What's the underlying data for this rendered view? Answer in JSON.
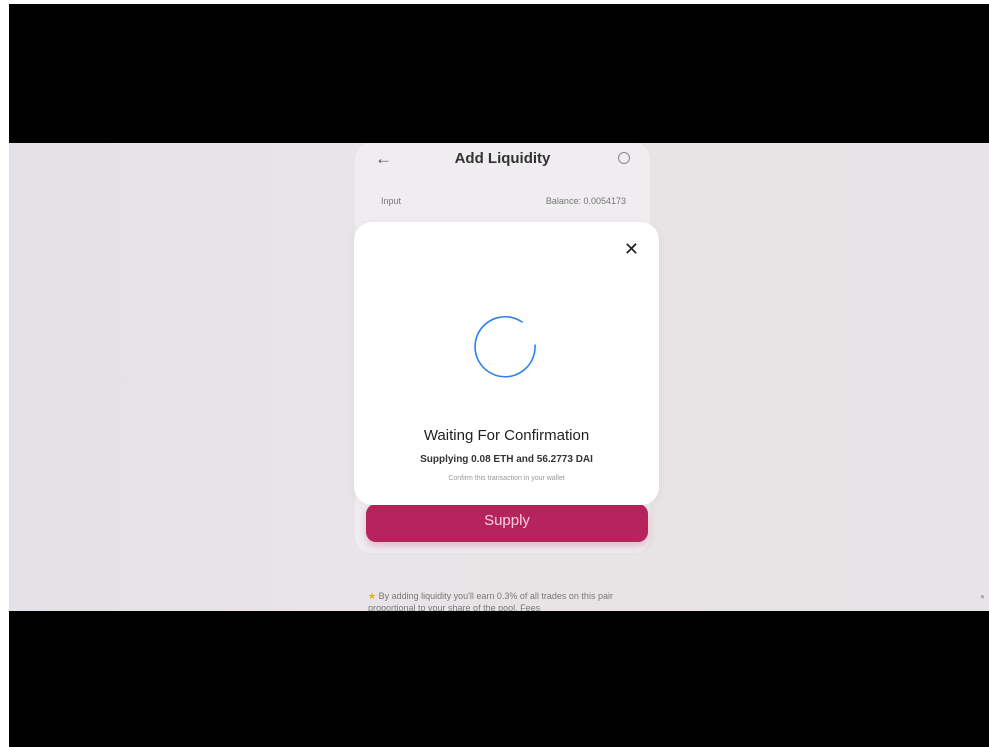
{
  "card": {
    "title": "Add Liquidity",
    "input_label": "Input",
    "balance": "Balance: 0.0054173",
    "supply_button": "Supply",
    "note": "By adding liquidity you'll earn 0.3% of all trades on this pair proportional to your share of the pool. Fees"
  },
  "modal": {
    "status_title": "Waiting For Confirmation",
    "detail": "Supplying 0.08 ETH and 56.2773 DAI",
    "hint": "Confirm this transaction in your wallet"
  },
  "icons": {
    "back": "arrow-left-icon",
    "help": "question-circle-icon",
    "close": "close-icon",
    "spinner": "loading-spinner-icon"
  },
  "colors": {
    "accent": "#b7235c",
    "spinner": "#2f80ed"
  }
}
